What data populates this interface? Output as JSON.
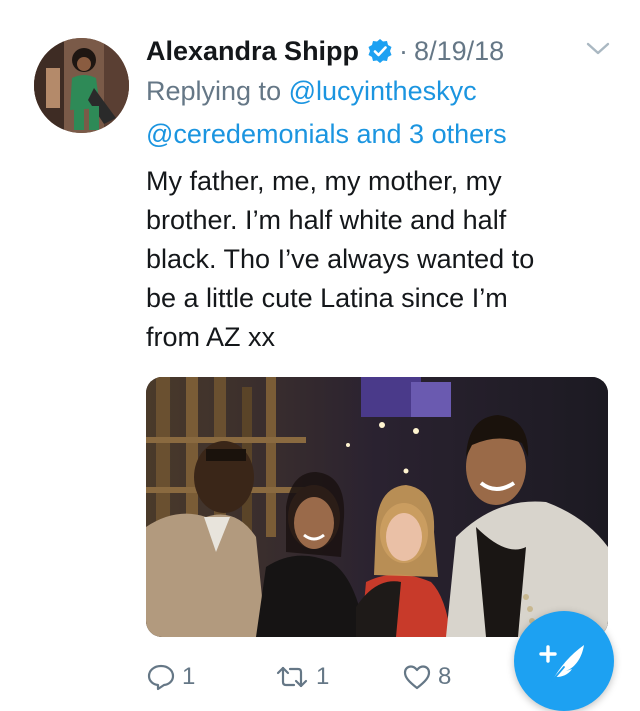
{
  "tweet": {
    "author_name": "Alexandra Shipp",
    "separator": "·",
    "date": "8/19/18",
    "replying_prefix": "Replying to",
    "mention_1": "@lucyintheskyc",
    "mention_2": "@ceredemonials and 3 others",
    "body_lines": [
      "My father, me, my mother, my",
      "brother. I’m half white and half",
      "black. Tho I’ve always wanted to",
      "be a little cute Latina since I’m",
      "from AZ xx"
    ]
  },
  "actions": {
    "reply_count": "1",
    "retweet_count": "1",
    "like_count": "8"
  },
  "icons": {
    "verified": "verified-badge-icon",
    "chevron": "chevron-down-icon",
    "reply": "reply-icon",
    "retweet": "retweet-icon",
    "like": "heart-icon",
    "compose": "compose-tweet-icon"
  },
  "colors": {
    "brand_blue": "#1da1f2",
    "link_blue": "#1b95e0",
    "text_dark": "#14171a",
    "text_gray": "#657786"
  }
}
